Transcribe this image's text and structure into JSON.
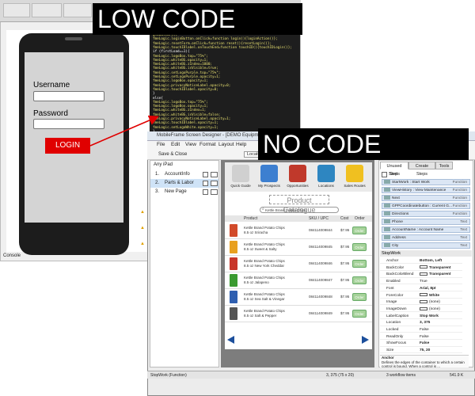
{
  "banners": {
    "low_code": "LOW CODE",
    "no_code": "NO CODE"
  },
  "top_window": {
    "tabs": [
      "",
      ""
    ],
    "username_label": "Username",
    "password_label": "Password",
    "login_label": "LOGIN",
    "console_label": "Console",
    "code_lines": [
      "globalVars({",
      "fmeLogic.loginButton.onClick=function login(){loginAction()};",
      "fmeLogic.resetForm.onClick=function reset(){resetLogin()};",
      "fmeLogic.touchIDlabel.onTouchEnd=function touchID(){touchIDLogin()};",
      "if (firstLoad==1){",
      "  fmeLogic.logoBox.top=\"75%\";",
      "  fmeLogic.whiteBG.opacity=1;",
      "  fmeLogic.whiteBG.zIndex=1000;",
      "  fmeLogic.whiteBG.isVisible=true;",
      "  fmeLogic.setLogoPurple.top=\"75%\";",
      "  fmeLogic.setLogoPurple.opacity=1;",
      "  fmeLogic.logoBox.opacity=1;",
      "  fmeLogic.privacyNoticeLabel.opacity=0;",
      "  fmeLogic.touchIDlabel.opacity=0;",
      "}",
      "else{",
      "  fmeLogic.logoBox.top=\"75%\";",
      "  fmeLogic.logoBox.opacity=1;",
      "  fmeLogic.whiteBG.zIndex=1;",
      "  fmeLogic.whiteBG.isVisible=false;",
      "  fmeLogic.privacyNoticeLabel.opacity=1;",
      "  fmeLogic.touchIDlabel.opacity=1;",
      "  fmeLogic.setLogoWhite.opacity=1;",
      "}"
    ]
  },
  "bottom_window": {
    "title": "MobileFrame Screen Designer - [DEMO Equipment Service]",
    "menu": [
      "File",
      "Edit",
      "View",
      "Format",
      "Layout",
      "Help"
    ],
    "toolbar": {
      "save_close": "Save & Close",
      "tab": "Location/Navigation"
    },
    "tree": {
      "header": "Any iPad",
      "items": [
        {
          "num": "1.",
          "label": "AccountInfo"
        },
        {
          "num": "2.",
          "label": "Parts & Labor"
        },
        {
          "num": "3.",
          "label": "New Page"
        }
      ]
    },
    "app": {
      "toolbar_items": [
        {
          "label": "Quick Guide",
          "color": "#d0d0d0"
        },
        {
          "label": "My Prospects",
          "color": "#3d7fd0"
        },
        {
          "label": "Opportunities",
          "color": "#c0392b"
        },
        {
          "label": "Locations",
          "color": "#2e86c1"
        },
        {
          "label": "Sales Routes",
          "color": "#f0c020"
        }
      ],
      "catalogue_title": "Product Catalogue",
      "search_text": "Kettle Brand Potato Chips",
      "columns": [
        "Product",
        "SKU / UPC",
        "Cost",
        "Order"
      ],
      "products": [
        {
          "name": "Kettle Brand Potato Chips 8.5 oz Sriracha",
          "upc": "084114009844",
          "cost": "$7.95",
          "order": "Order",
          "color": "#d24a2a"
        },
        {
          "name": "Kettle Brand Potato Chips 8.5 oz Sweet & Salty",
          "upc": "084114009845",
          "cost": "$7.95",
          "order": "Order",
          "color": "#e8a020"
        },
        {
          "name": "Kettle Brand Potato Chips 8.5 oz New York Cheddar",
          "upc": "084114009846",
          "cost": "$7.95",
          "order": "Order",
          "color": "#c8362a"
        },
        {
          "name": "Kettle Brand Potato Chips 8.5 oz Jalapeno",
          "upc": "084114009847",
          "cost": "$7.95",
          "order": "Order",
          "color": "#3a9a30"
        },
        {
          "name": "Kettle Brand Potato Chips 8.5 oz Sea Salt & Vinegar",
          "upc": "084114009848",
          "cost": "$7.95",
          "order": "Order",
          "color": "#2f5fb0"
        },
        {
          "name": "Kettle Brand Potato Chips 8.5 oz Salt & Pepper",
          "upc": "084114009849",
          "cost": "$7.95",
          "order": "Order",
          "color": "#555555"
        }
      ]
    },
    "right_panel": {
      "tabs": [
        "Unused Steps",
        "Create Steps",
        "Tools"
      ],
      "sort_label": "Sort",
      "steps": [
        {
          "label": "StartWork : Start Work",
          "type": "Function"
        },
        {
          "label": "ViewHistory : View Maintenance",
          "type": "Function"
        },
        {
          "label": "Next",
          "type": "Function"
        },
        {
          "label": "GPPCoordinatebutton : Current G...",
          "type": "Function"
        },
        {
          "label": "Directions",
          "type": "Function"
        },
        {
          "label": "Phone",
          "type": "Text"
        },
        {
          "label": "AccountName : Account Name",
          "type": "Text"
        },
        {
          "label": "Address",
          "type": "Text"
        },
        {
          "label": "City",
          "type": "Text"
        }
      ],
      "properties_header": "StopWork",
      "properties": [
        {
          "key": "Anchor",
          "value": "Bottom, Left",
          "bold": true
        },
        {
          "key": "BackColor",
          "value": "Transparent",
          "bold": true,
          "swatch": "#ffffff"
        },
        {
          "key": "BackColorBlend",
          "value": "Transparent",
          "bold": true,
          "swatch": "#ffffff"
        },
        {
          "key": "Enabled",
          "value": "True",
          "bold": false
        },
        {
          "key": "Font",
          "value": "Arial, 8pt",
          "bold": true
        },
        {
          "key": "ForeColor",
          "value": "White",
          "bold": true,
          "swatch": "#ffffff"
        },
        {
          "key": "Image",
          "value": "(none)",
          "bold": false,
          "swatch": "#ffffff"
        },
        {
          "key": "ImageDown",
          "value": "(none)",
          "bold": false,
          "swatch": "#ffffff"
        },
        {
          "key": "LabelCaption",
          "value": "Stop Work",
          "bold": true
        },
        {
          "key": "Location",
          "value": "3, 375",
          "bold": true
        },
        {
          "key": "Locked",
          "value": "False",
          "bold": false
        },
        {
          "key": "ReadOnly",
          "value": "False",
          "bold": false
        },
        {
          "key": "ShowFocus",
          "value": "False",
          "bold": true
        },
        {
          "key": "Size",
          "value": "75, 20",
          "bold": true
        }
      ],
      "description_title": "Anchor",
      "description": "Defines the edges of the container to which a certain control is bound. When a control is ..."
    },
    "status": {
      "left": "StopWork (Function)",
      "coords": "3, 375 (75 x 20)",
      "workflow": "3 workflow items",
      "zoom": "541.9 K"
    }
  }
}
